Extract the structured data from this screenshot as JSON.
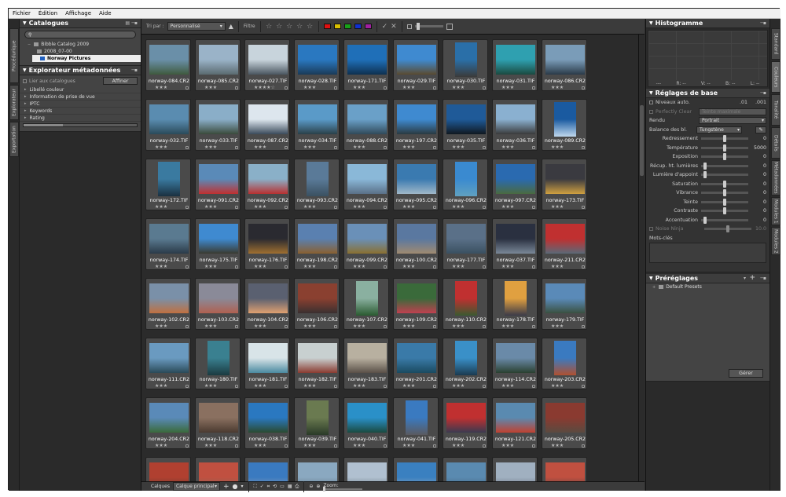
{
  "menu": [
    "Fichier",
    "Édition",
    "Affichage",
    "Aide"
  ],
  "left_tabs": [
    "Procédurique",
    "Explorateur",
    "Exportation"
  ],
  "right_tabs": [
    "Standard",
    "Couleurs",
    "Tonalité",
    "Détails",
    "Métadonnées",
    "Modules 1",
    "Modules 2"
  ],
  "catalogues": {
    "title": "Catalogues",
    "tree": [
      "Bibble Catalog 2009",
      "2008_07-00",
      "Norway Pictures"
    ]
  },
  "metadata_explorer": {
    "title": "Explorateur métadonnées",
    "link_label": "Lier aux catalogues",
    "apply_label": "Affiner",
    "items": [
      "Libellé couleur",
      "Information de prise de vue",
      "IPTC",
      "Keywords",
      "Rating"
    ]
  },
  "toolbar": {
    "sort_label": "Tri par :",
    "sort_value": "Personnalisé",
    "filter_label": "Filtre",
    "colors": [
      "#e01010",
      "#d8c000",
      "#18a018",
      "#1030d0",
      "#a020a0"
    ]
  },
  "thumbnails": [
    {
      "name": "norway-084.CR2",
      "stars": "★★★",
      "c1": "#6a8fa8",
      "c2": "#3f5a3e"
    },
    {
      "name": "norway-085.CR2",
      "stars": "★★★",
      "c1": "#9ab3c8",
      "c2": "#5a6a70"
    },
    {
      "name": "norway-027.TIF",
      "stars": "★★★★☆",
      "c1": "#c8d4dc",
      "c2": "#4a5660"
    },
    {
      "name": "norway-028.TIF",
      "stars": "★★★",
      "c1": "#2a78c0",
      "c2": "#1a3a58"
    },
    {
      "name": "norway-171.TIF",
      "stars": "★★★",
      "c1": "#1f6fb8",
      "c2": "#0e3050"
    },
    {
      "name": "norway-029.TIF",
      "stars": "★★★",
      "c1": "#3f8ad0",
      "c2": "#5a4a30"
    },
    {
      "name": "norway-030.TIF",
      "stars": "★★★",
      "c1": "#2a6fa8",
      "c2": "#3a3a3a",
      "tall": true
    },
    {
      "name": "norway-031.TIF",
      "stars": "★★★",
      "c1": "#2fa0b0",
      "c2": "#1a4a40"
    },
    {
      "name": "norway-086.CR2",
      "stars": "★★★",
      "c1": "#7a9cb8",
      "c2": "#2a3a48"
    },
    {
      "name": "norway-032.TIF",
      "stars": "★★★",
      "c1": "#5a8cb0",
      "c2": "#2a4a5a"
    },
    {
      "name": "norway-033.TIF",
      "stars": "★★★",
      "c1": "#8aaec8",
      "c2": "#3a4a3a"
    },
    {
      "name": "norway-087.CR2",
      "stars": "★★★",
      "c1": "#dde6ee",
      "c2": "#3a4a5a"
    },
    {
      "name": "norway-034.TIF",
      "stars": "★★★",
      "c1": "#5a9ac8",
      "c2": "#2a4048"
    },
    {
      "name": "norway-088.CR2",
      "stars": "★★★",
      "c1": "#6aa0c8",
      "c2": "#304a5a"
    },
    {
      "name": "norway-197.CR2",
      "stars": "★★★",
      "c1": "#3f8ad0",
      "c2": "#2a3a40"
    },
    {
      "name": "norway-035.TIF",
      "stars": "★★★",
      "c1": "#1f5a98",
      "c2": "#101820"
    },
    {
      "name": "norway-036.TIF",
      "stars": "★★★",
      "c1": "#8ab0d0",
      "c2": "#3a3a3a"
    },
    {
      "name": "norway-089.CR2",
      "stars": "★★★",
      "c1": "#1a5aa0",
      "c2": "#c0d8ee",
      "tall": true
    },
    {
      "name": "norway-172.TIF",
      "stars": "★★★",
      "c1": "#3a7aa0",
      "c2": "#1a3040",
      "tall": true
    },
    {
      "name": "norway-091.CR2",
      "stars": "★★★",
      "c1": "#5a8ab8",
      "c2": "#c03030"
    },
    {
      "name": "norway-092.CR2",
      "stars": "★★★",
      "c1": "#8ab0c8",
      "c2": "#b83030"
    },
    {
      "name": "norway-093.CR2",
      "stars": "★★★",
      "c1": "#5a7a98",
      "c2": "#3a5060",
      "tall": true
    },
    {
      "name": "norway-094.CR2",
      "stars": "★★★",
      "c1": "#8ab8d8",
      "c2": "#5a7088"
    },
    {
      "name": "norway-095.CR2",
      "stars": "★★★",
      "c1": "#3a7ab0",
      "c2": "#a0b8c8"
    },
    {
      "name": "norway-096.CR2",
      "stars": "★★★",
      "c1": "#3a8ad0",
      "c2": "#60a0c0",
      "tall": true
    },
    {
      "name": "norway-097.CR2",
      "stars": "★★★",
      "c1": "#2a6ab0",
      "c2": "#4a6a40"
    },
    {
      "name": "norway-173.TIF",
      "stars": "★★★",
      "c1": "#3a3a40",
      "c2": "#d0a040"
    },
    {
      "name": "norway-174.TIF",
      "stars": "★★★",
      "c1": "#5a7a90",
      "c2": "#2a3a48"
    },
    {
      "name": "norway-175.TIF",
      "stars": "★★★",
      "c1": "#3f8ad0",
      "c2": "#3a3a30"
    },
    {
      "name": "norway-176.TIF",
      "stars": "★★★",
      "c1": "#2a2a30",
      "c2": "#a07030"
    },
    {
      "name": "norway-198.CR2",
      "stars": "★★★",
      "c1": "#5a80b0",
      "c2": "#8a6030"
    },
    {
      "name": "norway-099.CR2",
      "stars": "★★★",
      "c1": "#6a90b8",
      "c2": "#8a7030"
    },
    {
      "name": "norway-100.CR2",
      "stars": "★★★",
      "c1": "#5a78a0",
      "c2": "#a08a70"
    },
    {
      "name": "norway-177.TIF",
      "stars": "★★★",
      "c1": "#5a7088",
      "c2": "#3a5060"
    },
    {
      "name": "norway-037.TIF",
      "stars": "★★★",
      "c1": "#2a3040",
      "c2": "#7a8898"
    },
    {
      "name": "norway-211.CR2",
      "stars": "★★★",
      "c1": "#c03030",
      "c2": "#5a6a78"
    },
    {
      "name": "norway-102.CR2",
      "stars": "★★★",
      "c1": "#7a90a8",
      "c2": "#c07040"
    },
    {
      "name": "norway-103.CR2",
      "stars": "★★★",
      "c1": "#8a8a98",
      "c2": "#b06050"
    },
    {
      "name": "norway-104.CR2",
      "stars": "★★★",
      "c1": "#5a6070",
      "c2": "#e0a070"
    },
    {
      "name": "norway-106.CR2",
      "stars": "★★★",
      "c1": "#8a4030",
      "c2": "#3a3030"
    },
    {
      "name": "norway-107.CR2",
      "stars": "★★★",
      "c1": "#8ab0a0",
      "c2": "#2a5a30",
      "tall": true
    },
    {
      "name": "norway-109.CR2",
      "stars": "★★★",
      "c1": "#3a6a3a",
      "c2": "#c04050"
    },
    {
      "name": "norway-110.CR2",
      "stars": "★★★",
      "c1": "#c03030",
      "c2": "#3a5a30",
      "tall": true
    },
    {
      "name": "norway-178.TIF",
      "stars": "★★★",
      "c1": "#e0a040",
      "c2": "#3a3a48",
      "tall": true
    },
    {
      "name": "norway-179.TIF",
      "stars": "★★★",
      "c1": "#5a8ab8",
      "c2": "#3a5040"
    },
    {
      "name": "norway-111.CR2",
      "stars": "★★★",
      "c1": "#6a9ac0",
      "c2": "#2a4a58"
    },
    {
      "name": "norway-180.TIF",
      "stars": "★★★",
      "c1": "#3a8090",
      "c2": "#1a3a40",
      "tall": true
    },
    {
      "name": "norway-181.TIF",
      "stars": "★★★",
      "c1": "#d8e4e8",
      "c2": "#4a8aa0"
    },
    {
      "name": "norway-182.TIF",
      "stars": "★★★",
      "c1": "#c8d0d0",
      "c2": "#8a3a30"
    },
    {
      "name": "norway-183.TIF",
      "stars": "★★★",
      "c1": "#b8b0a0",
      "c2": "#5a5048"
    },
    {
      "name": "norway-201.CR2",
      "stars": "★★★",
      "c1": "#3a7aa8",
      "c2": "#1a4a60"
    },
    {
      "name": "norway-202.CR2",
      "stars": "★★★",
      "c1": "#3a90c8",
      "c2": "#1a3a50",
      "tall": true
    },
    {
      "name": "norway-114.CR2",
      "stars": "★★★",
      "c1": "#6a8aa8",
      "c2": "#2a4030"
    },
    {
      "name": "norway-203.CR2",
      "stars": "★★★",
      "c1": "#3a7ac0",
      "c2": "#b05030",
      "tall": true
    },
    {
      "name": "norway-204.CR2",
      "stars": "★★★",
      "c1": "#5a8ab8",
      "c2": "#3a6a3a"
    },
    {
      "name": "norway-118.CR2",
      "stars": "★★★",
      "c1": "#8a7060",
      "c2": "#4a3a30"
    },
    {
      "name": "norway-038.TIF",
      "stars": "★★★",
      "c1": "#2a78c0",
      "c2": "#2a4a30"
    },
    {
      "name": "norway-039.TIF",
      "stars": "★★★",
      "c1": "#6a7a50",
      "c2": "#2a3a28",
      "tall": true
    },
    {
      "name": "norway-040.TIF",
      "stars": "★★★",
      "c1": "#2a90c8",
      "c2": "#1a4a40"
    },
    {
      "name": "norway-041.TIF",
      "stars": "★★★",
      "c1": "#3a7ac0",
      "c2": "#5a5a60",
      "tall": true
    },
    {
      "name": "norway-119.CR2",
      "stars": "★★★",
      "c1": "#c03030",
      "c2": "#3a3a50"
    },
    {
      "name": "norway-121.CR2",
      "stars": "★★★",
      "c1": "#5a8ab0",
      "c2": "#c04030"
    },
    {
      "name": "norway-205.CR2",
      "stars": "★★★",
      "c1": "#8a3a30",
      "c2": "#5a4a40"
    },
    {
      "name": "",
      "stars": "",
      "c1": "#b04030",
      "c2": "#5a3a30"
    },
    {
      "name": "",
      "stars": "",
      "c1": "#c05040",
      "c2": "#7a6a60"
    },
    {
      "name": "",
      "stars": "",
      "c1": "#3a7ac0",
      "c2": "#a0a8b0"
    },
    {
      "name": "",
      "stars": "",
      "c1": "#8aa8c0",
      "c2": "#5a6a78"
    },
    {
      "name": "",
      "stars": "",
      "c1": "#b0c0d0",
      "c2": "#5a6a70"
    },
    {
      "name": "",
      "stars": "",
      "c1": "#3a80c0",
      "c2": "#a0b0c0"
    },
    {
      "name": "",
      "stars": "",
      "c1": "#5a8ab0",
      "c2": "#3a5a70"
    },
    {
      "name": "",
      "stars": "",
      "c1": "#a0b0c0",
      "c2": "#5a6070"
    },
    {
      "name": "",
      "stars": "",
      "c1": "#c05040",
      "c2": "#3a3a40"
    }
  ],
  "bottombar": {
    "layers_label": "Calques",
    "layer_value": "Calque principal",
    "zoom_label": "Zoom:"
  },
  "histogram": {
    "title": "Histogramme",
    "axis": [
      "---",
      "R: --",
      "V: --",
      "B: --",
      "L: --"
    ]
  },
  "basic": {
    "title": "Réglages de base",
    "auto_levels": "Niveaux auto.",
    "auto_levels_v1": ".01",
    "auto_levels_v2": ".001",
    "perfectly_clear": "Perfectly Clear",
    "perfectly_clear_value": "Teinte maximale",
    "render_label": "Rendu",
    "render_value": "Portrait",
    "wb_label": "Balance des bl.",
    "wb_value": "Tungstène",
    "sliders": [
      {
        "label": "Redressement",
        "value": "0",
        "pos": 0.5
      },
      {
        "label": "Température",
        "value": "5000",
        "pos": 0.5
      },
      {
        "label": "Exposition",
        "value": "0",
        "pos": 0.5
      },
      {
        "label": "Récup. ht. lumières",
        "value": "0",
        "pos": 0.05
      },
      {
        "label": "Lumière d'appoint",
        "value": "0",
        "pos": 0.05
      },
      {
        "label": "Saturation",
        "value": "0",
        "pos": 0.5
      },
      {
        "label": "Vibrance",
        "value": "0",
        "pos": 0.5
      },
      {
        "label": "Teinte",
        "value": "0",
        "pos": 0.5
      },
      {
        "label": "Contraste",
        "value": "0",
        "pos": 0.5
      },
      {
        "label": "Accentuation",
        "value": "0",
        "pos": 0.05
      }
    ],
    "noise_label": "Noise Ninja",
    "noise_value": "10.0",
    "keywords_label": "Mots-clés"
  },
  "presets": {
    "title": "Préréglages",
    "items": [
      "Default Presets"
    ],
    "manage_label": "Gérer"
  }
}
